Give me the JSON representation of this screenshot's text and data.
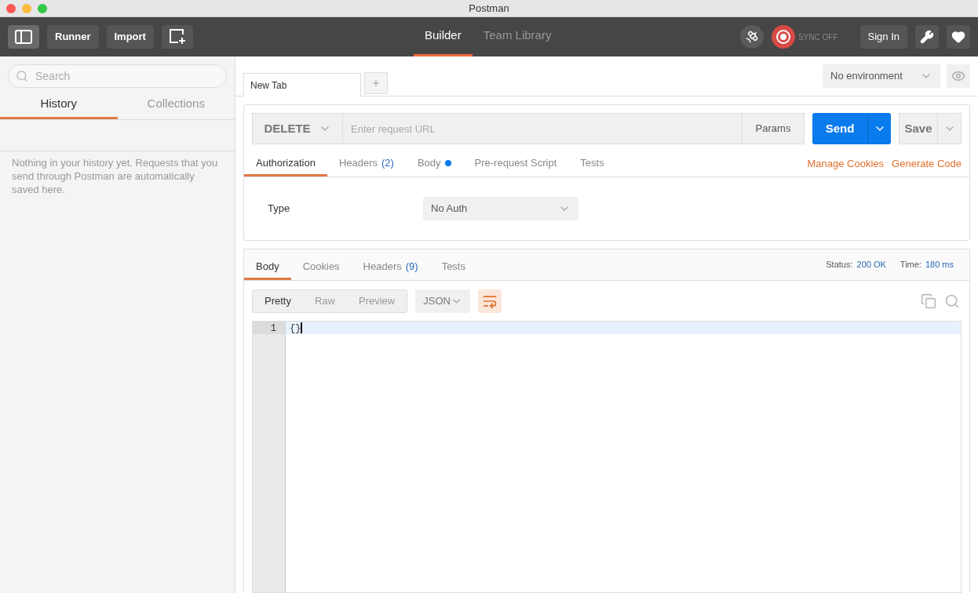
{
  "window": {
    "title": "Postman"
  },
  "toolbar": {
    "sidebar_toggle_on": true,
    "buttons": [
      "Runner",
      "Import"
    ],
    "tabs": [
      {
        "label": "Builder",
        "selected": true
      },
      {
        "label": "Team Library",
        "selected": false
      }
    ],
    "sync": {
      "label": "SYNC OFF"
    },
    "sign_in": "Sign In"
  },
  "sidebar": {
    "search": {
      "placeholder": "Search"
    },
    "tabs": [
      {
        "label": "History",
        "selected": true
      },
      {
        "label": "Collections",
        "selected": false
      }
    ],
    "empty_message": "Nothing in your history yet. Requests that you send through Postman are automatically saved here."
  },
  "request_tabs": [
    {
      "label": "New Tab",
      "selected": true
    }
  ],
  "environment": {
    "value": "No environment"
  },
  "request": {
    "method": "DELETE",
    "url": {
      "placeholder": "Enter request URL"
    },
    "params": "Params",
    "send": "Send",
    "save": "Save",
    "tabs": [
      {
        "label": "Authorization",
        "dot": false,
        "selected": true
      },
      {
        "label": "Headers",
        "count": "(2)",
        "dot": false,
        "selected": false
      },
      {
        "label": "Body",
        "dot": true,
        "selected": false
      },
      {
        "label": "Pre-request Script",
        "dot": false,
        "selected": false
      },
      {
        "label": "Tests",
        "dot": false,
        "selected": false
      }
    ],
    "links": [
      "Manage Cookies",
      "Generate Code"
    ],
    "auth": {
      "label": "Type",
      "value": "No Auth"
    }
  },
  "response": {
    "tabs": [
      {
        "label": "Body",
        "selected": true
      },
      {
        "label": "Cookies",
        "selected": false
      },
      {
        "label": "Headers",
        "count": "(9)",
        "selected": false
      },
      {
        "label": "Tests",
        "selected": false
      }
    ],
    "status": {
      "label": "Status:",
      "value": "200 OK"
    },
    "time": {
      "label": "Time:",
      "value": "180 ms"
    },
    "views": [
      {
        "label": "Pretty",
        "selected": true
      },
      {
        "label": "Raw",
        "selected": false
      },
      {
        "label": "Preview",
        "selected": false
      }
    ],
    "format": "JSON",
    "wrap_on": true,
    "lines": [
      {
        "number": "1",
        "text": "{}",
        "current": true
      }
    ]
  }
}
